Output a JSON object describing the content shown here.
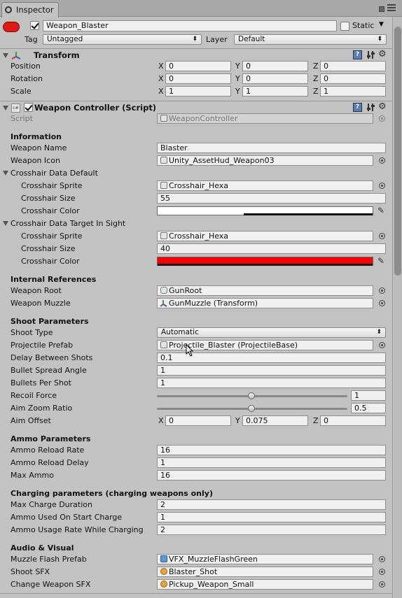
{
  "tab": {
    "label": "Inspector"
  },
  "object": {
    "name": "Weapon_Blaster",
    "static_label": "Static",
    "tag_label": "Tag",
    "tag_value": "Untagged",
    "layer_label": "Layer",
    "layer_value": "Default"
  },
  "transform": {
    "title": "Transform",
    "rows": [
      {
        "label": "Position",
        "x": "0",
        "y": "0",
        "z": "0"
      },
      {
        "label": "Rotation",
        "x": "0",
        "y": "0",
        "z": "0"
      },
      {
        "label": "Scale",
        "x": "1",
        "y": "1",
        "z": "1"
      }
    ],
    "axis_x": "X",
    "axis_y": "Y",
    "axis_z": "Z"
  },
  "weapon_controller": {
    "title": "Weapon Controller (Script)",
    "script_label": "Script",
    "script_value": "WeaponController",
    "info_header": "Information",
    "weapon_name_label": "Weapon Name",
    "weapon_name_value": "Blaster",
    "weapon_icon_label": "Weapon Icon",
    "weapon_icon_value": "Unity_AssetHud_Weapon03",
    "crosshair_default_header": "Crosshair Data Default",
    "crosshair_sprite_label": "Crosshair Sprite",
    "crosshair_sprite_value": "Crosshair_Hexa",
    "crosshair_size_label": "Crosshair Size",
    "crosshair_size_default": "55",
    "crosshair_color_label": "Crosshair Color",
    "crosshair_default_color": "#ffffff",
    "crosshair_target_header": "Crosshair Data Target In Sight",
    "crosshair_sprite_target_value": "Crosshair_Hexa",
    "crosshair_size_target": "40",
    "crosshair_target_color": "#ff0000",
    "internal_header": "Internal References",
    "weapon_root_label": "Weapon Root",
    "weapon_root_value": "GunRoot",
    "weapon_muzzle_label": "Weapon Muzzle",
    "weapon_muzzle_value": "GunMuzzle (Transform)",
    "shoot_header": "Shoot Parameters",
    "shoot_type_label": "Shoot Type",
    "shoot_type_value": "Automatic",
    "projectile_prefab_label": "Projectile Prefab",
    "projectile_prefab_value": "Projectile_Blaster (ProjectileBase)",
    "delay_label": "Delay Between Shots",
    "delay_value": "0.1",
    "spread_label": "Bullet Spread Angle",
    "spread_value": "1",
    "bullets_label": "Bullets Per Shot",
    "bullets_value": "1",
    "recoil_label": "Recoil Force",
    "recoil_value": "1",
    "aimzoom_label": "Aim Zoom Ratio",
    "aimzoom_value": "0.5",
    "aimoffset_label": "Aim Offset",
    "aimoffset_x": "0",
    "aimoffset_y": "0.075",
    "aimoffset_z": "0",
    "ammo_header": "Ammo Parameters",
    "reload_rate_label": "Ammo Reload Rate",
    "reload_rate_value": "16",
    "reload_delay_label": "Ammo Reload Delay",
    "reload_delay_value": "1",
    "max_ammo_label": "Max Ammo",
    "max_ammo_value": "16",
    "charging_header": "Charging parameters (charging weapons only)",
    "max_charge_label": "Max Charge Duration",
    "max_charge_value": "2",
    "ammo_start_label": "Ammo Used On Start Charge",
    "ammo_start_value": "1",
    "ammo_usage_label": "Ammo Usage Rate While Charging",
    "ammo_usage_value": "2",
    "audio_header": "Audio & Visual",
    "muzzle_flash_label": "Muzzle Flash Prefab",
    "muzzle_flash_value": "VFX_MuzzleFlashGreen",
    "shoot_sfx_label": "Shoot SFX",
    "shoot_sfx_value": "Blaster_Shot",
    "change_sfx_label": "Change Weapon SFX",
    "change_sfx_value": "Pickup_Weapon_Small"
  },
  "colors": {
    "accent_red": "#ff0000",
    "bg": "#c2c2c2"
  }
}
